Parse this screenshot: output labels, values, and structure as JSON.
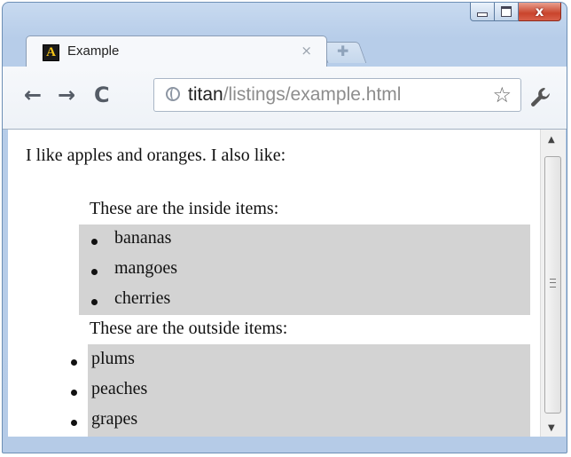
{
  "window": {
    "caption": {
      "minimize_icon": "minimize-icon",
      "maximize_icon": "maximize-icon",
      "close_label": "x"
    }
  },
  "tab": {
    "title": "Example",
    "favicon_letter": "A",
    "close_label": "×",
    "new_tab_icon": "plus-icon"
  },
  "toolbar": {
    "back_label": "←",
    "forward_label": "→",
    "reload_label": "C",
    "url_host": "titan",
    "url_path": "/listings/example.html",
    "star_label": "☆",
    "wrench_label": "🔧"
  },
  "page": {
    "intro": "I like apples and oranges. I also like:",
    "inside_label": "These are the inside items:",
    "inside_items": [
      "bananas",
      "mangoes",
      "cherries"
    ],
    "outside_label": "These are the outside items:",
    "outside_items": [
      "plums",
      "peaches",
      "grapes"
    ]
  },
  "scrollbar": {
    "up_label": "▲",
    "down_label": "▼"
  },
  "colors": {
    "list_background": "#d3d3d3",
    "frame": "#b7cde9",
    "close_button": "#c9442c"
  }
}
